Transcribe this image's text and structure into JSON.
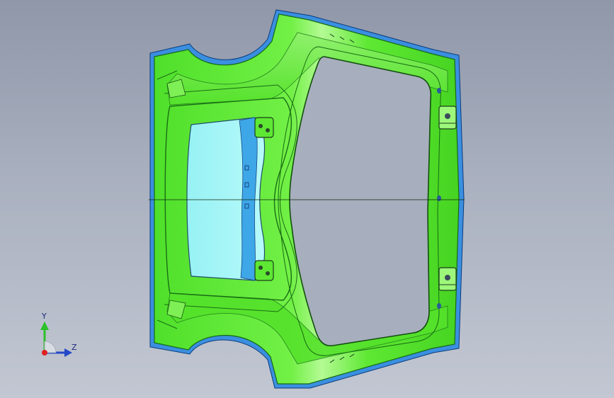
{
  "viewport": {
    "model": "tailgate-inner-panel",
    "colors": {
      "background_top": "#8f97a9",
      "background_bottom": "#c2c7d2",
      "part_main": "#59e82e",
      "part_light": "#9cf77a",
      "part_edge": "#1d8a14",
      "flange_blue": "#3a8fe0",
      "glass": "#a6f6f7",
      "glass_strip": "#3da7e8"
    }
  },
  "triad": {
    "y_label": "Y",
    "z_label": "Z",
    "icon": "coordinate-triad-icon"
  }
}
